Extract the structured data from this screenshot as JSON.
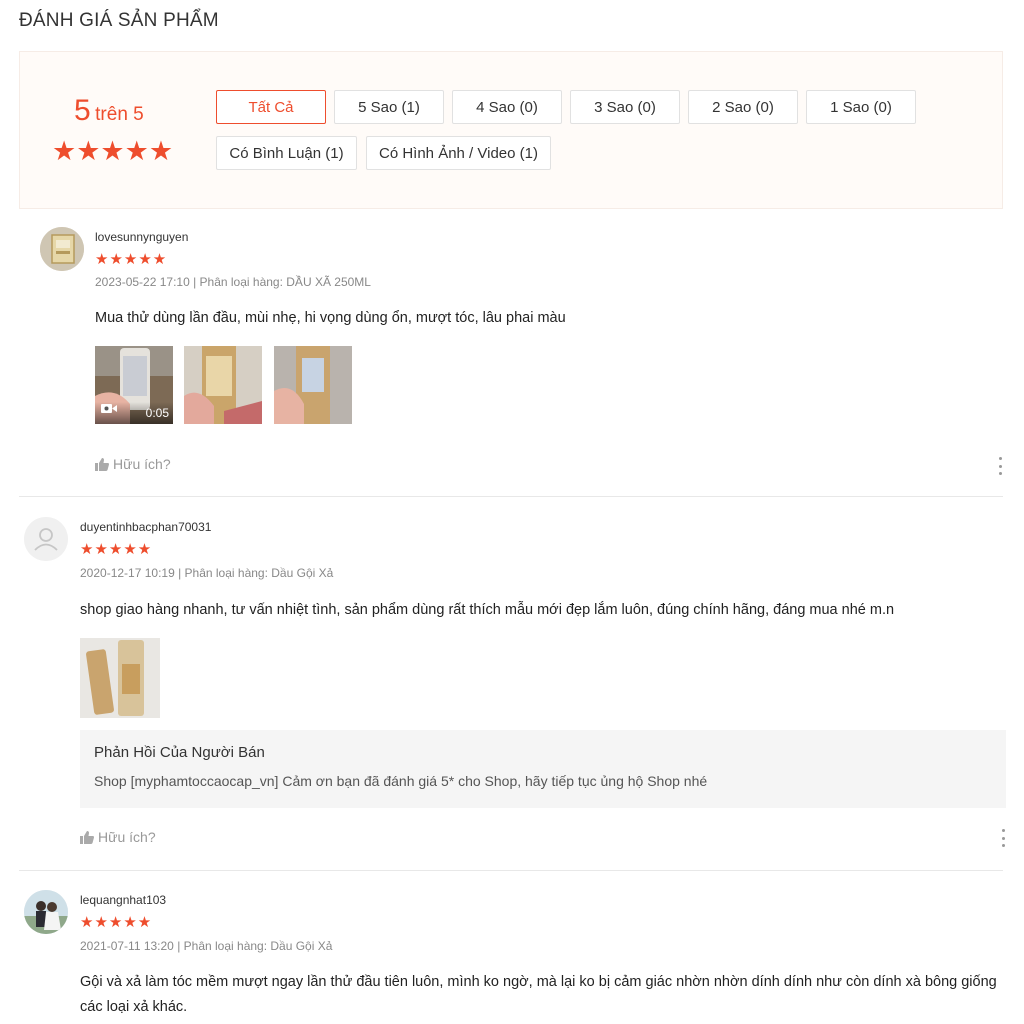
{
  "page": {
    "title": "ĐÁNH GIÁ SẢN PHẨM"
  },
  "overview": {
    "score": "5",
    "score_suffix": "trên 5",
    "stars": "★★★★★",
    "rating_value": 5,
    "filters": [
      {
        "label": "Tất Cả",
        "active": true
      },
      {
        "label": "5 Sao (1)"
      },
      {
        "label": "4 Sao (0)"
      },
      {
        "label": "3 Sao (0)"
      },
      {
        "label": "2 Sao (0)"
      },
      {
        "label": "1 Sao (0)"
      },
      {
        "label": "Có Bình Luận (1)"
      },
      {
        "label": "Có Hình Ảnh / Video (1)"
      }
    ]
  },
  "reviews": [
    {
      "username": "lovesunnynguyen",
      "stars": "★★★★★",
      "meta": "2023-05-22 17:10 | Phân loại hàng: DẦU XÃ 250ML",
      "content": "Mua thử dùng lần đầu, mùi nhẹ, hi vọng dùng ổn, mượt tóc, lâu phai màu",
      "video_duration": "0:05",
      "helpful": "Hữu ích?"
    },
    {
      "username": "duyentinhbacphan70031",
      "stars": "★★★★★",
      "meta": "2020-12-17 10:19 | Phân loại hàng: Dầu Gội Xả",
      "content": "shop giao hàng nhanh, tư vấn nhiệt tình,  sản phẩm dùng rất thích mẫu mới đẹp lắm luôn, đúng chính hãng, đáng mua nhé m.n",
      "seller_reply_title": "Phản Hồi Của Người Bán",
      "seller_reply": "Shop [myphamtoccaocap_vn] Cảm ơn bạn đã đánh giá 5* cho Shop, hãy tiếp tục ủng hộ Shop nhé",
      "helpful": "Hữu ích?"
    },
    {
      "username": "lequangnhat103",
      "stars": "★★★★★",
      "meta": "2021-07-11 13:20 | Phân loại hàng: Dầu Gội Xả",
      "content": "Gội và xả làm tóc mềm mượt ngay lần thử đầu tiên luôn, mình ko ngờ, mà lại ko bị cảm giác nhờn nhờn dính dính như còn dính xà bông giống các loại xả khác."
    }
  ]
}
